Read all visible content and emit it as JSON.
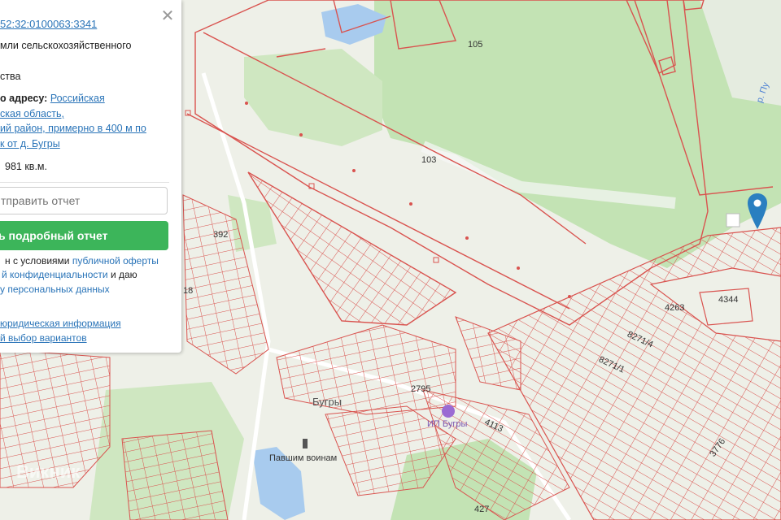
{
  "panel": {
    "cadastral_number": "52:32:0100063:3341",
    "category_line1": "мли сельскохозяйственного",
    "category_line2": "ства",
    "address_label": "о адресу:",
    "address_line1": "Российская",
    "address_line2": "ская область,",
    "address_line3": "ий район, примерно в 400 м по",
    "address_line4": "к от д. Бугры",
    "area": "981 кв.м.",
    "email_placeholder": "тправить отчет",
    "report_button": "ь подробный отчет",
    "terms_line1_plain": "н с условиями",
    "terms_line1_link": "публичной оферты",
    "terms_line2_link": "й конфиденциальности",
    "terms_line2_plain": "и даю",
    "terms_line3_link": "у персональных данных",
    "legal_info_link": "юридическая информация",
    "variants_link": "й выбор вариантов",
    "close_symbol": "✕"
  },
  "map": {
    "labels": {
      "p105": "105",
      "p103": "103",
      "p392": "392",
      "p18": "18",
      "p4263": "4263",
      "p4344": "4344",
      "p8271_4": "8271/4",
      "p8271_1": "8271/1",
      "p2795": "2795",
      "p4113": "4113",
      "p3776": "3776",
      "p427": "427",
      "town": "Бугры",
      "monument": "Павшим воинам",
      "ip_bugry": "ИП Бугры",
      "river": "р. Пу",
      "watermark": "Викник"
    },
    "colors": {
      "parcel_line": "#d9534f",
      "forest": "#c3e3b4",
      "water": "#a8cbee",
      "background": "#eef0e8",
      "marker": "#2a7fc0"
    }
  }
}
